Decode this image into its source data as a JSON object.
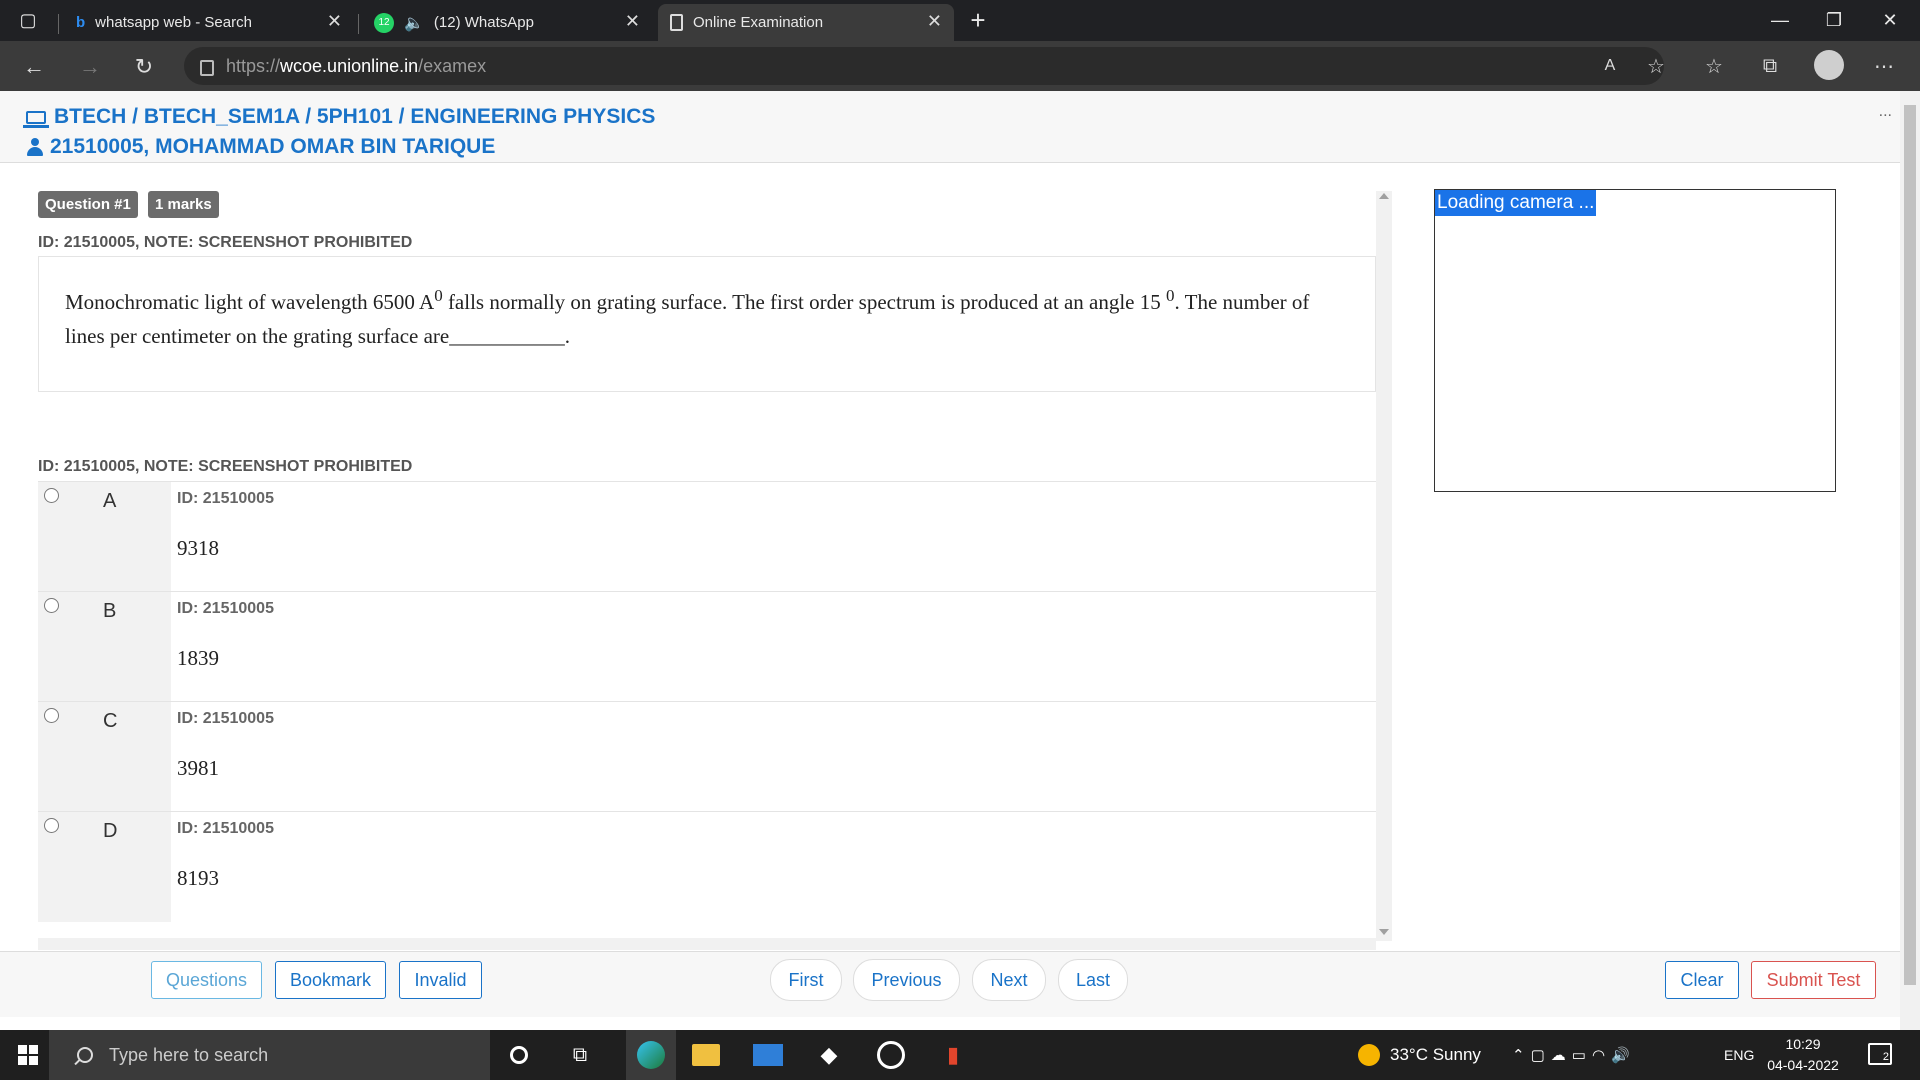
{
  "browser": {
    "tabs": [
      {
        "title": "whatsapp web - Search",
        "icon": "bing-icon"
      },
      {
        "title": "(12) WhatsApp",
        "icon": "whatsapp-icon",
        "badge": "12"
      },
      {
        "title": "Online Examination",
        "icon": "page-icon"
      }
    ],
    "url": {
      "scheme": "https://",
      "host": "wcoe.unionline.in",
      "path": "/examex"
    }
  },
  "header": {
    "course_path": "BTECH / BTECH_SEM1A / 5PH101 / ENGINEERING PHYSICS",
    "student": "21510005, MOHAMMAD OMAR BIN TARIQUE",
    "menu": "..."
  },
  "question": {
    "number_badge": "Question #1",
    "marks_badge": "1 marks",
    "note": "ID: 21510005, NOTE: SCREENSHOT PROHIBITED",
    "text_part1": "Monochromatic light of wavelength 6500 A",
    "sup1": "0",
    "text_part2": " falls normally on grating surface. The first order spectrum is produced at an angle 15 ",
    "sup2": "0",
    "text_part3": ". The number of lines per centimeter on the grating surface are___________.",
    "options_note": "ID: 21510005, NOTE: SCREENSHOT PROHIBITED",
    "options": [
      {
        "letter": "A",
        "id": "ID: 21510005",
        "value": "9318"
      },
      {
        "letter": "B",
        "id": "ID: 21510005",
        "value": "1839"
      },
      {
        "letter": "C",
        "id": "ID: 21510005",
        "value": "3981"
      },
      {
        "letter": "D",
        "id": "ID: 21510005",
        "value": "8193"
      }
    ]
  },
  "camera": {
    "label": "Loading camera ..."
  },
  "footer": {
    "questions": "Questions",
    "bookmark": "Bookmark",
    "invalid": "Invalid",
    "first": "First",
    "previous": "Previous",
    "next": "Next",
    "last": "Last",
    "clear": "Clear",
    "submit": "Submit Test"
  },
  "taskbar": {
    "search_placeholder": "Type here to search",
    "weather": "33°C  Sunny",
    "lang": "ENG",
    "time": "10:29",
    "date": "04-04-2022",
    "notifications": "2"
  }
}
